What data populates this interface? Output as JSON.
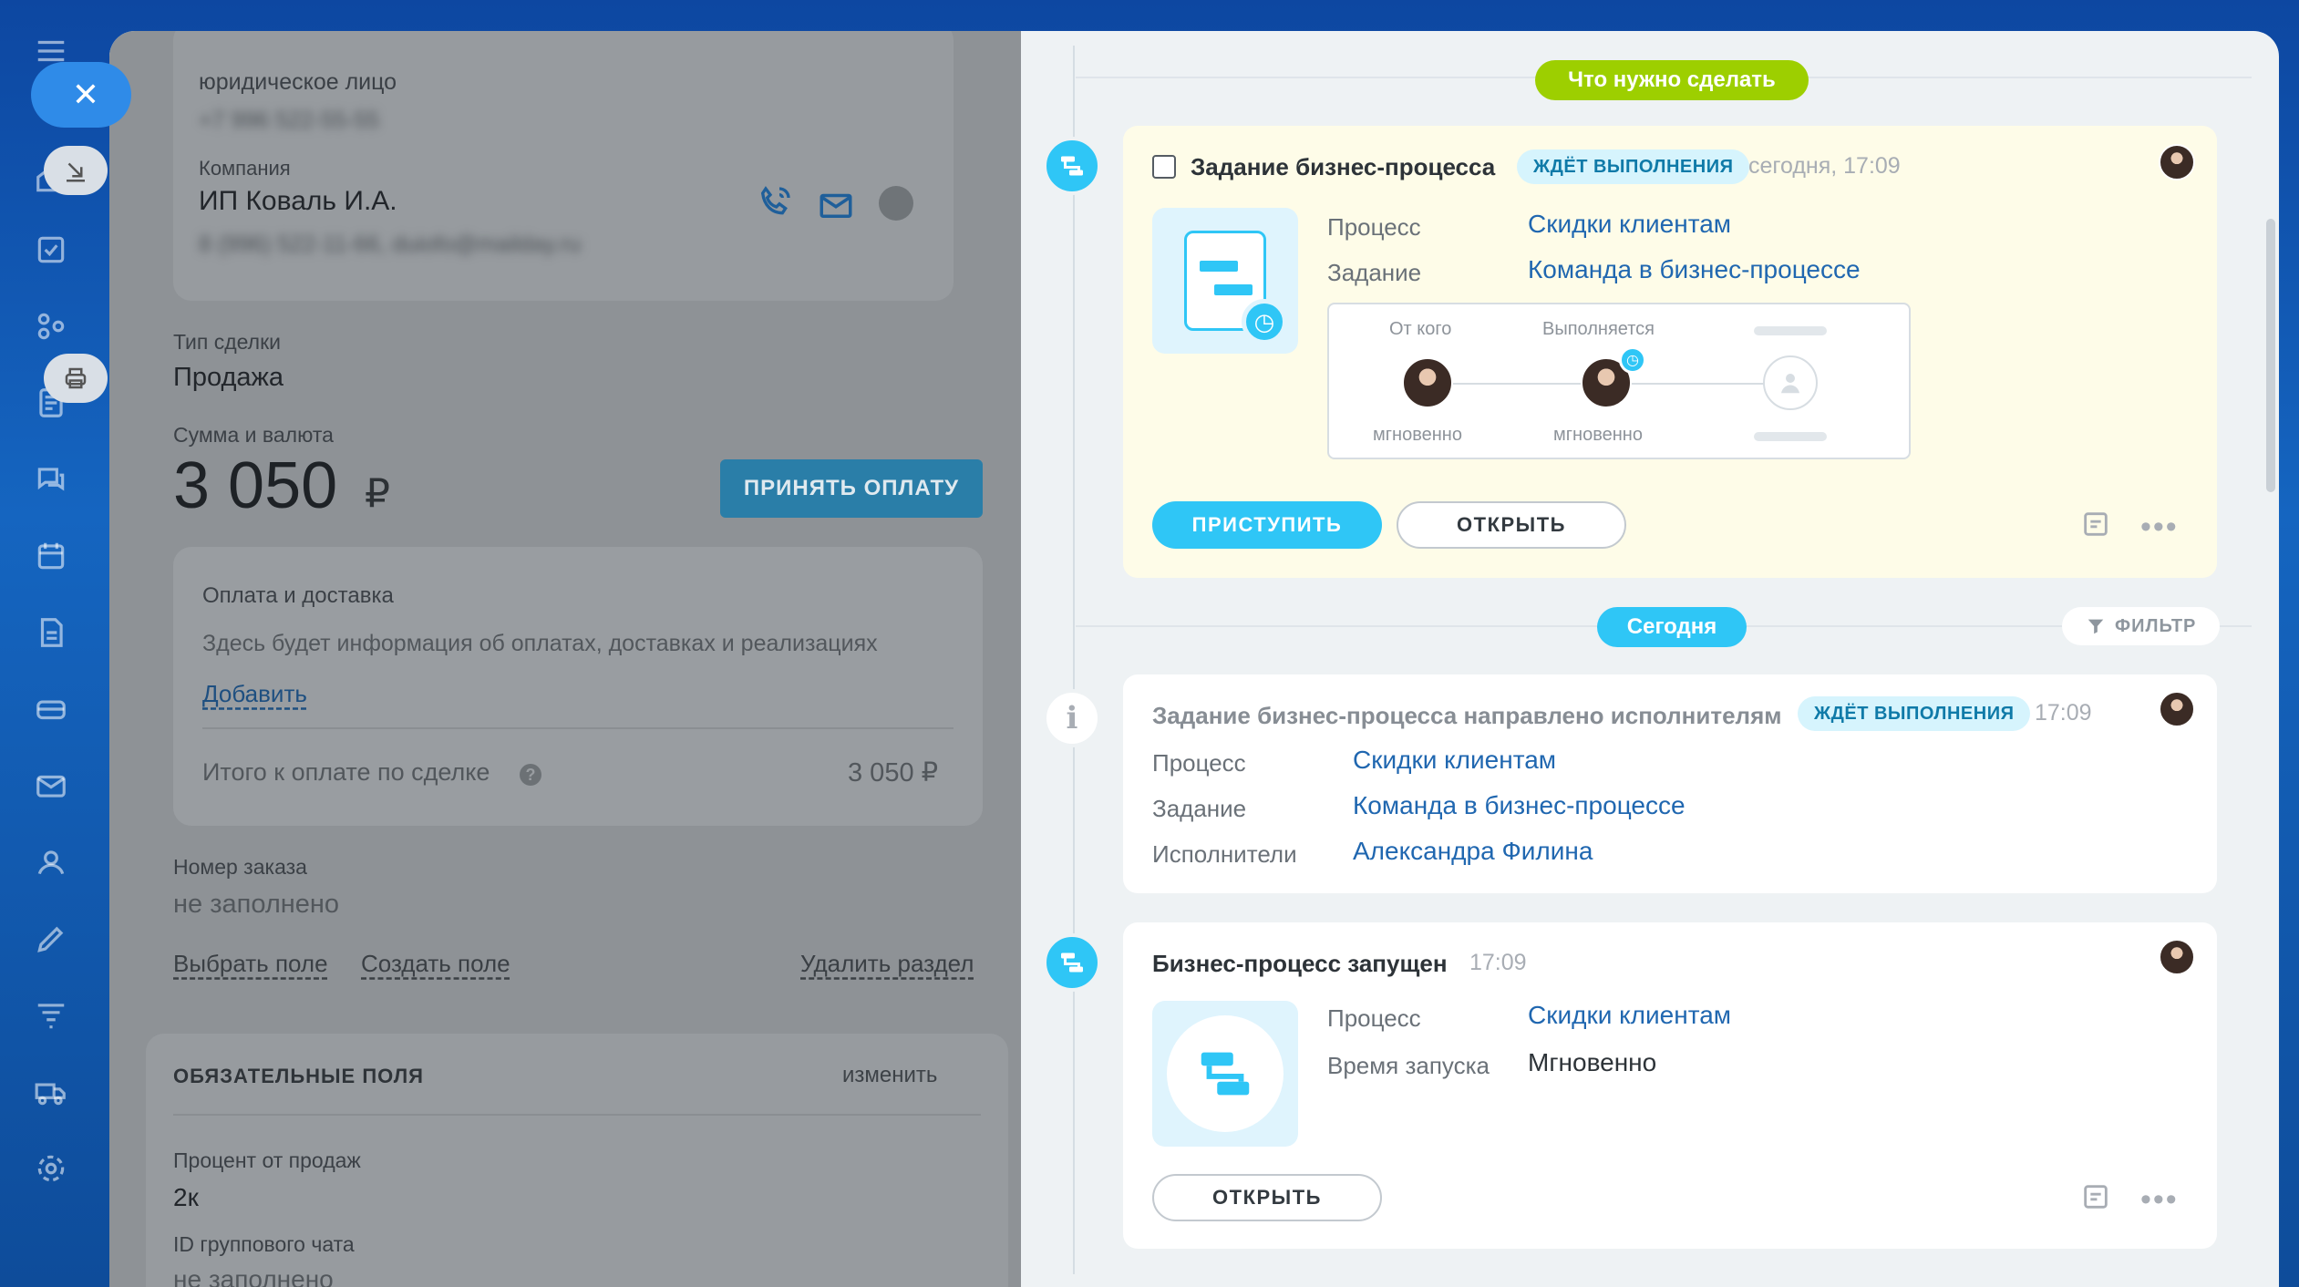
{
  "left_form": {
    "contact_type": "юридическое лицо",
    "contact_phone_blurred": "+7 996 522-55-55",
    "company_label": "Компания",
    "company_name": "ИП Коваль И.А.",
    "company_details_blurred": "8 (996) 522-11-66, duiofo@mailday.ru",
    "deal_type_label": "Тип сделки",
    "deal_type_value": "Продажа",
    "amount_label": "Сумма и валюта",
    "amount_value": "3 050",
    "currency": "₽",
    "accept_payment_button": "ПРИНЯТЬ ОПЛАТУ",
    "payment_block_title": "Оплата и доставка",
    "payment_block_text": "Здесь будет информация об оплатах, доставках и реализациях",
    "add_link": "Добавить",
    "total_label": "Итого к оплате по сделке",
    "total_value": "3 050 ₽",
    "order_number_label": "Номер заказа",
    "order_number_value": "не заполнено",
    "choose_field_link": "Выбрать поле",
    "create_field_link": "Создать поле",
    "delete_section_link": "Удалить раздел",
    "required_fields_title": "ОБЯЗАТЕЛЬНЫЕ ПОЛЯ",
    "change_link": "изменить",
    "sales_percent_label": "Процент от продаж",
    "sales_percent_value": "2к",
    "group_chat_label": "ID группового чата",
    "group_chat_value": "не заполнено"
  },
  "timeline": {
    "todo_tag": "Что нужно сделать",
    "today_tag": "Сегодня",
    "filter_label": "ФИЛЬТР",
    "task_card": {
      "title": "Задание бизнес-процесса",
      "badge": "ЖДЁТ ВЫПОЛНЕНИЯ",
      "time": "сегодня, 17:09",
      "process_label": "Процесс",
      "process_value": "Скидки клиентам",
      "task_label": "Задание",
      "task_value": "Команда в бизнес-процессе",
      "from_label": "От кого",
      "executing_label": "Выполняется",
      "from_time": "мгновенно",
      "executing_time": "мгновенно",
      "start_button": "ПРИСТУПИТЬ",
      "open_button": "ОТКРЫТЬ"
    },
    "sent_card": {
      "title": "Задание бизнес-процесса направлено исполнителям",
      "badge": "ЖДЁТ ВЫПОЛНЕНИЯ",
      "time": "17:09",
      "process_label": "Процесс",
      "process_value": "Скидки клиентам",
      "task_label": "Задание",
      "task_value": "Команда в бизнес-процессе",
      "executors_label": "Исполнители",
      "executors_value": "Александра Филина"
    },
    "started_card": {
      "title": "Бизнес-процесс запущен",
      "time": "17:09",
      "process_label": "Процесс",
      "process_value": "Скидки клиентам",
      "start_time_label": "Время запуска",
      "start_time_value": "Мгновенно",
      "open_button": "ОТКРЫТЬ"
    }
  },
  "colors": {
    "accent": "#2fc6f6",
    "todo_green": "#9dcf00",
    "link_blue": "#2067b0"
  }
}
